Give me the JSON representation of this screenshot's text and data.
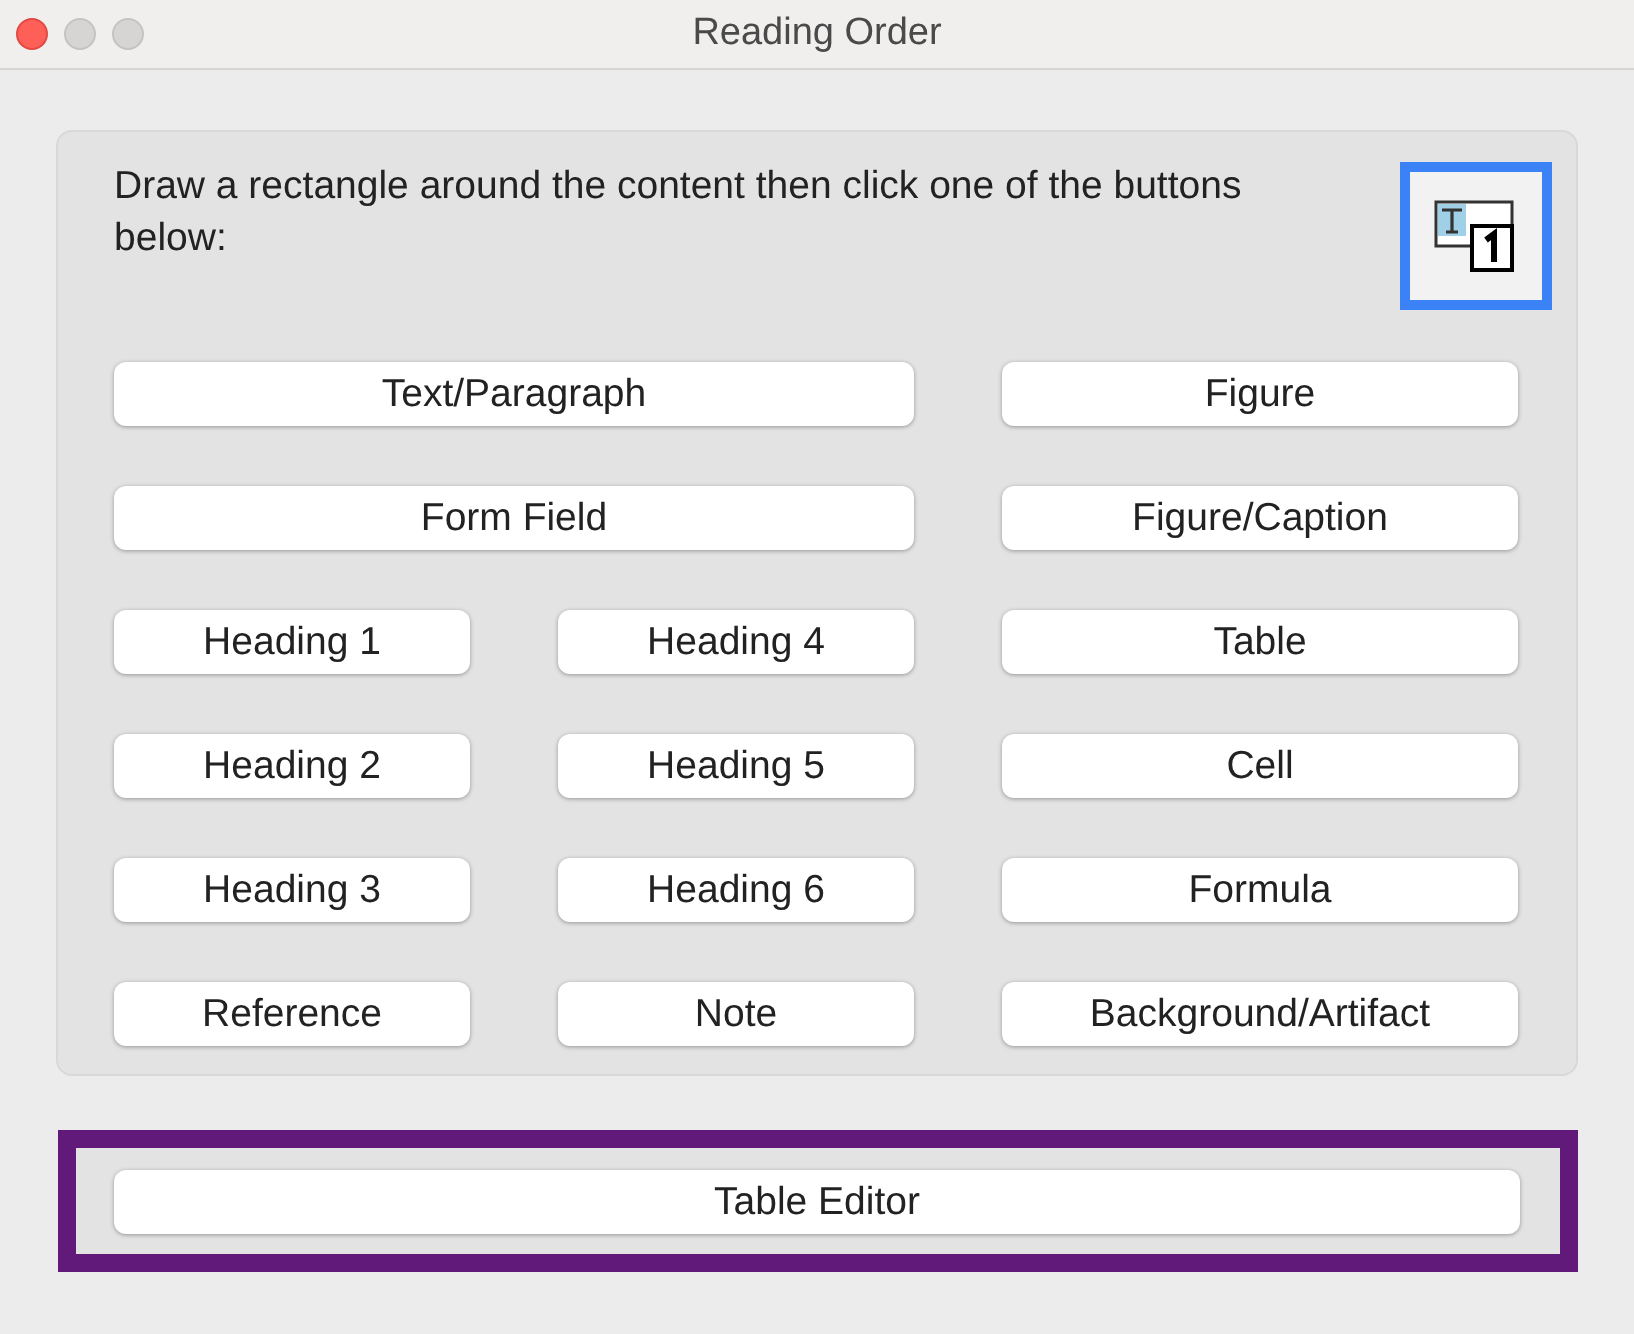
{
  "window": {
    "title": "Reading Order"
  },
  "instructions": "Draw a rectangle around the content then click one of the buttons below:",
  "tool_button": {
    "selected": true
  },
  "buttons": [
    {
      "label": "Text/Paragraph",
      "kind": "wide"
    },
    {
      "label": "Figure",
      "kind": "side"
    },
    {
      "label": "Form Field",
      "kind": "wide"
    },
    {
      "label": "Figure/Caption",
      "kind": "side"
    },
    {
      "label": "Heading 1",
      "kind": "normal"
    },
    {
      "label": "Heading 4",
      "kind": "normal"
    },
    {
      "label": "Table",
      "kind": "side"
    },
    {
      "label": "Heading 2",
      "kind": "normal"
    },
    {
      "label": "Heading 5",
      "kind": "normal"
    },
    {
      "label": "Cell",
      "kind": "side"
    },
    {
      "label": "Heading 3",
      "kind": "normal"
    },
    {
      "label": "Heading 6",
      "kind": "normal"
    },
    {
      "label": "Formula",
      "kind": "side"
    },
    {
      "label": "Reference",
      "kind": "normal"
    },
    {
      "label": "Note",
      "kind": "normal"
    },
    {
      "label": "Background/Artifact",
      "kind": "side"
    }
  ],
  "footer_button": {
    "label": "Table Editor"
  }
}
